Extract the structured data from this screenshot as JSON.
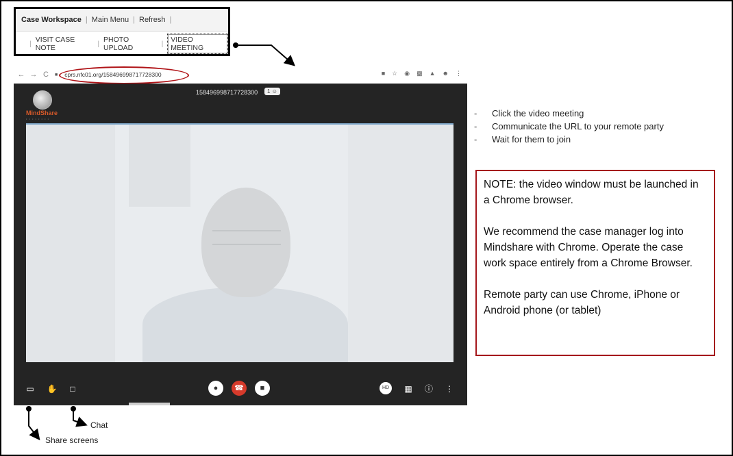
{
  "workspace": {
    "title": "Case Workspace",
    "menu_items": [
      "Main Menu",
      "Refresh"
    ],
    "tabs": [
      "VISIT CASE NOTE",
      "PHOTO UPLOAD",
      "VIDEO MEETING"
    ]
  },
  "browser": {
    "url": "cprs.nfc01.org/158496998717728300",
    "logo_text": "MindShare",
    "meeting_id": "158496998717728300",
    "participant_count": "1"
  },
  "steps": [
    "Click the video meeting",
    "Communicate the URL to your remote party",
    "Wait for them to join"
  ],
  "note": {
    "p1": "NOTE: the video window must be launched  in a Chrome browser.",
    "p2": "We recommend the case manager log into Mindshare with Chrome. Operate the case work space entirely from a Chrome Browser.",
    "p3": "Remote party can use Chrome, iPhone or Android phone (or tablet)"
  },
  "callouts": {
    "chat": "Chat",
    "share": "Share screens"
  },
  "colors": {
    "note_border": "#a4161b",
    "url_ring": "#b01418",
    "hangup": "#d63a2b"
  }
}
